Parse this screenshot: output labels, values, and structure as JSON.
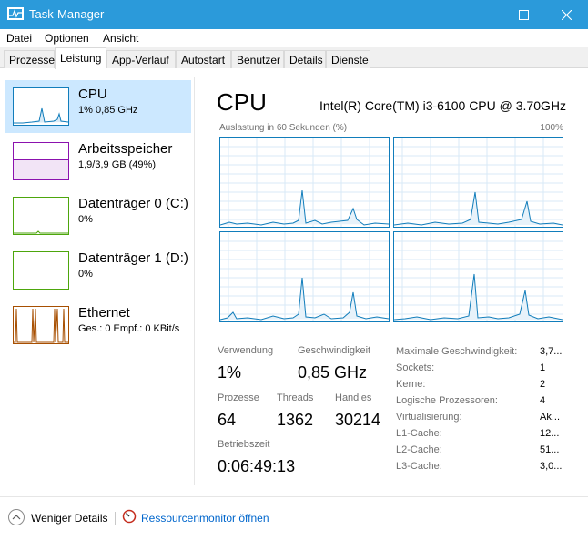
{
  "window": {
    "title": "Task-Manager",
    "icon": "task-manager-icon",
    "accent": "#2b9ada"
  },
  "menu": [
    "Datei",
    "Optionen",
    "Ansicht"
  ],
  "tabs": [
    {
      "label": "Prozesse",
      "active": false
    },
    {
      "label": "Leistung",
      "active": true
    },
    {
      "label": "App-Verlauf",
      "active": false
    },
    {
      "label": "Autostart",
      "active": false
    },
    {
      "label": "Benutzer",
      "active": false
    },
    {
      "label": "Details",
      "active": false
    },
    {
      "label": "Dienste",
      "active": false
    }
  ],
  "sidebar": [
    {
      "title": "CPU",
      "sub": "1%  0,85 GHz",
      "color": "#117dbb",
      "selected": true
    },
    {
      "title": "Arbeitsspeicher",
      "sub": "1,9/3,9 GB (49%)",
      "color": "#8b12ae",
      "selected": false
    },
    {
      "title": "Datenträger 0 (C:)",
      "sub": "0%",
      "color": "#4da60c",
      "selected": false
    },
    {
      "title": "Datenträger 1 (D:)",
      "sub": "0%",
      "color": "#4da60c",
      "selected": false
    },
    {
      "title": "Ethernet",
      "sub": "Ges.: 0 Empf.: 0 KBit/s",
      "color": "#a74f01",
      "selected": false
    }
  ],
  "detail": {
    "title": "CPU",
    "model": "Intel(R) Core(TM) i3-6100 CPU @ 3.70GHz",
    "graph_label": "Auslastung in 60 Sekunden (%)",
    "graph_max": "100%",
    "graph_color": "#117dbb"
  },
  "stats": {
    "usage_label": "Verwendung",
    "usage_value": "1%",
    "speed_label": "Geschwindigkeit",
    "speed_value": "0,85 GHz",
    "processes_label": "Prozesse",
    "processes_value": "64",
    "threads_label": "Threads",
    "threads_value": "1362",
    "handles_label": "Handles",
    "handles_value": "30214",
    "uptime_label": "Betriebszeit",
    "uptime_value": "0:06:49:13"
  },
  "specs": [
    {
      "k": "Maximale Geschwindigkeit:",
      "v": "3,7..."
    },
    {
      "k": "Sockets:",
      "v": "1"
    },
    {
      "k": "Kerne:",
      "v": "2"
    },
    {
      "k": "Logische Prozessoren:",
      "v": "4"
    },
    {
      "k": "Virtualisierung:",
      "v": "Ak..."
    },
    {
      "k": "L1-Cache:",
      "v": "12..."
    },
    {
      "k": "L2-Cache:",
      "v": "51..."
    },
    {
      "k": "L3-Cache:",
      "v": "3,0..."
    }
  ],
  "footer": {
    "fewer_details": "Weniger Details",
    "resource_monitor": "Ressourcenmonitor öffnen"
  }
}
